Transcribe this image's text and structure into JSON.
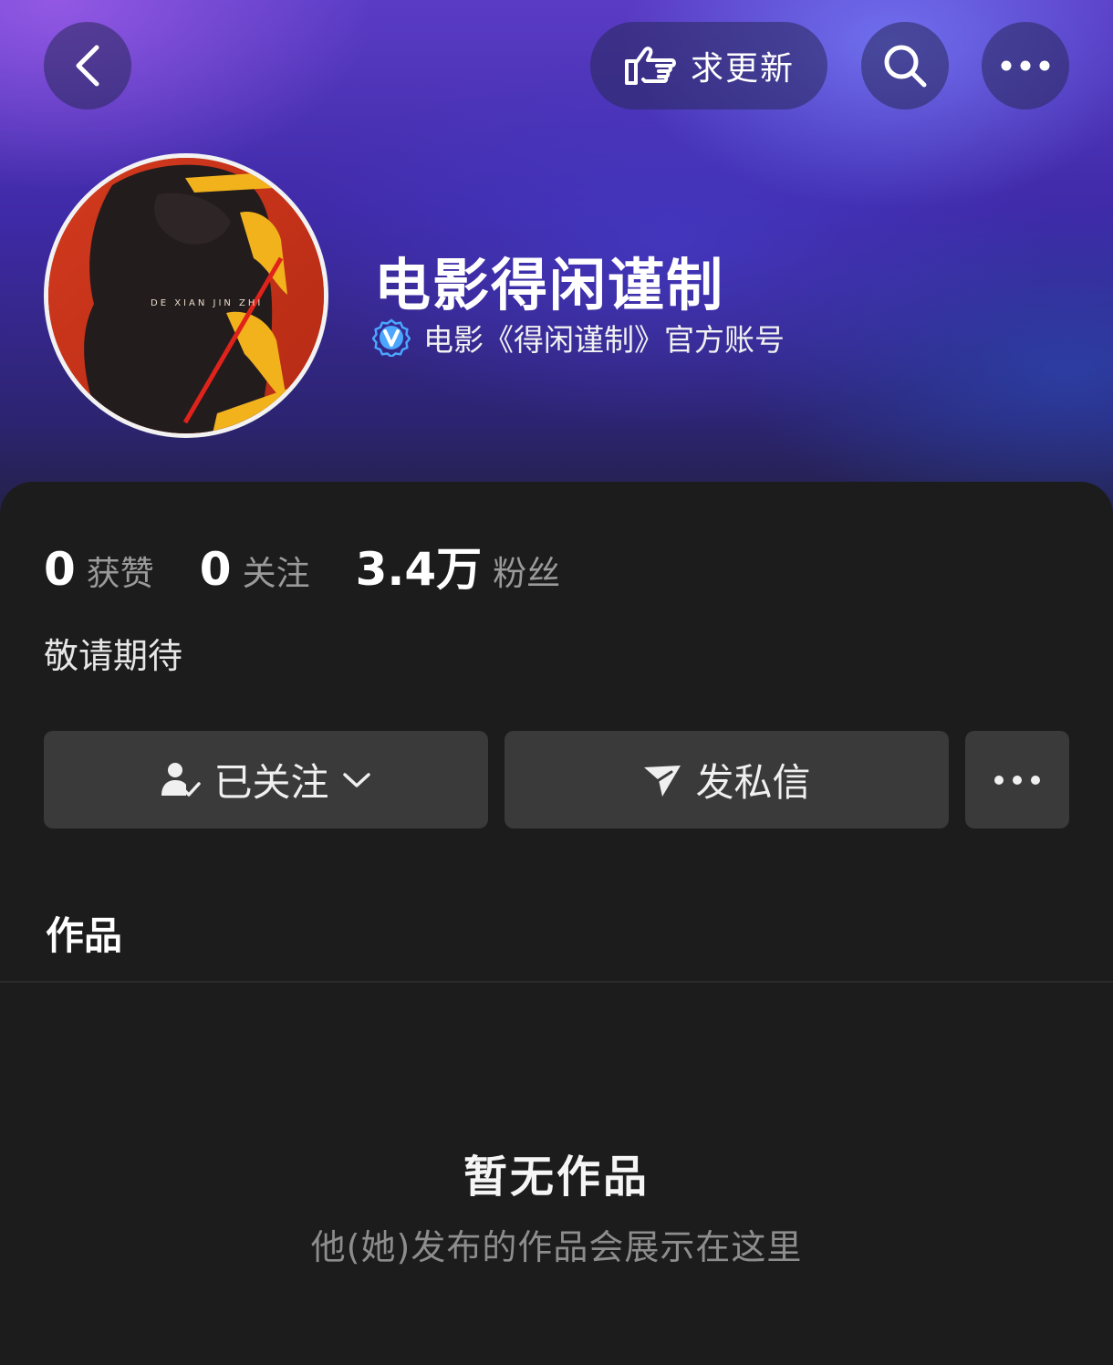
{
  "header": {
    "request_update_label": "求更新"
  },
  "profile": {
    "name": "电影得闲谨制",
    "verified_text": "电影《得闲谨制》官方账号",
    "avatar_text": "DE XIAN JIN ZHI"
  },
  "stats": [
    {
      "value": "0",
      "label": "获赞"
    },
    {
      "value": "0",
      "label": "关注"
    },
    {
      "value": "3.4万",
      "label": "粉丝"
    }
  ],
  "bio": "敬请期待",
  "actions": {
    "follow_label": "已关注",
    "message_label": "发私信"
  },
  "tabs": {
    "works": "作品"
  },
  "empty": {
    "title": "暂无作品",
    "subtitle": "他(她)发布的作品会展示在这里"
  },
  "colors": {
    "background": "#1c1c1c",
    "button": "#3a3a3a",
    "verified_badge": "#4aa6ff"
  }
}
